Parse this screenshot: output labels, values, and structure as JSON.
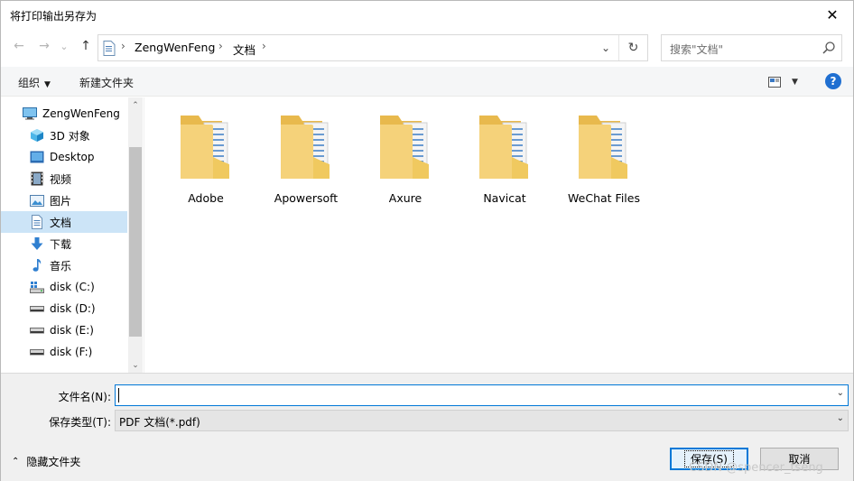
{
  "window": {
    "title": "将打印输出另存为",
    "close_glyph": "✕"
  },
  "nav": {
    "back_glyph": "←",
    "forward_glyph": "→",
    "history_glyph": "⌄",
    "up_glyph": "↑",
    "breadcrumb": [
      "ZengWenFeng",
      "文档"
    ],
    "chevron": "›",
    "dropdown_glyph": "⌄",
    "refresh_glyph": "↻",
    "search_placeholder": "搜索\"文档\""
  },
  "toolbar": {
    "organize_label": "组织",
    "organize_caret": "▼",
    "new_folder_label": "新建文件夹",
    "view_caret": "▼",
    "help_glyph": "?"
  },
  "sidebar": {
    "items": [
      {
        "label": "ZengWenFeng",
        "icon": "computer-icon"
      },
      {
        "label": "3D 对象",
        "icon": "cube-3d-icon"
      },
      {
        "label": "Desktop",
        "icon": "desktop-folder-icon"
      },
      {
        "label": "视频",
        "icon": "video-icon"
      },
      {
        "label": "图片",
        "icon": "pictures-icon"
      },
      {
        "label": "文档",
        "icon": "documents-icon",
        "selected": true
      },
      {
        "label": "下载",
        "icon": "download-icon"
      },
      {
        "label": "音乐",
        "icon": "music-icon"
      },
      {
        "label": "disk (C:)",
        "icon": "system-drive-icon"
      },
      {
        "label": "disk (D:)",
        "icon": "drive-icon"
      },
      {
        "label": "disk (E:)",
        "icon": "drive-icon"
      },
      {
        "label": "disk (F:)",
        "icon": "drive-icon"
      }
    ],
    "scroll_up_glyph": "⌃",
    "scroll_down_glyph": "⌄"
  },
  "folders": [
    {
      "name": "Adobe"
    },
    {
      "name": "Apowersoft"
    },
    {
      "name": "Axure"
    },
    {
      "name": "Navicat"
    },
    {
      "name": "WeChat Files"
    }
  ],
  "form": {
    "filename_label": "文件名(N):",
    "filename_value": "",
    "filetype_label": "保存类型(T):",
    "filetype_value": "PDF 文档(*.pdf)",
    "dropdown_glyph": "⌄"
  },
  "footer": {
    "hide_folders_label": "隐藏文件夹",
    "hide_folders_chevron": "⌃",
    "save_label": "保存(S)",
    "cancel_label": "取消",
    "watermark": "CSDN @spencer_tseng"
  },
  "colors": {
    "accent": "#0078d7",
    "selection": "#cce4f7",
    "folder": "#f5d27a",
    "help": "#1f6fd1"
  }
}
